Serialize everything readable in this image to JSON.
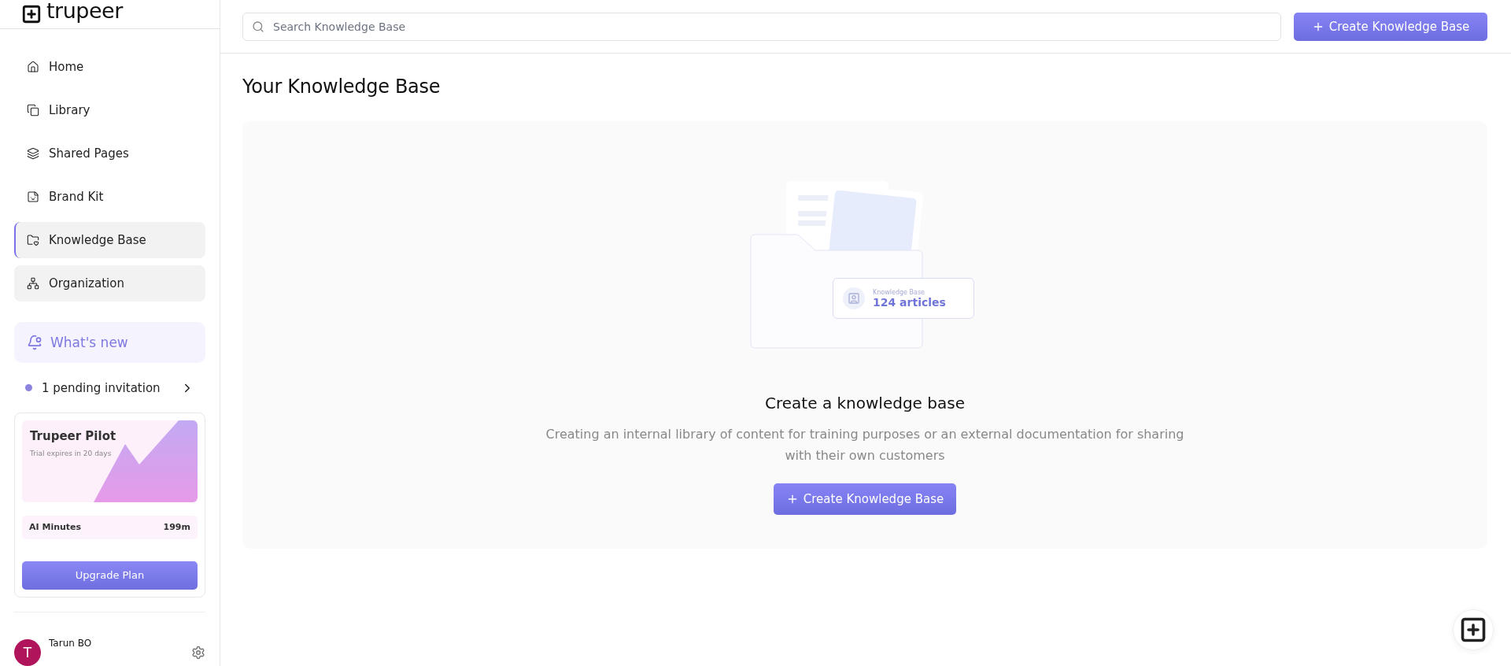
{
  "brand": {
    "name": "trupeer"
  },
  "sidebar": {
    "items": [
      {
        "label": "Home",
        "selected": false,
        "hovered": false
      },
      {
        "label": "Library",
        "selected": false,
        "hovered": false
      },
      {
        "label": "Shared Pages",
        "selected": false,
        "hovered": false
      },
      {
        "label": "Brand Kit",
        "selected": false,
        "hovered": false
      },
      {
        "label": "Knowledge Base",
        "selected": true,
        "hovered": false
      },
      {
        "label": "Organization",
        "selected": false,
        "hovered": true
      }
    ],
    "whats_new": "What's new",
    "invitation": "1 pending invitation",
    "plan_card": {
      "title": "Trupeer Pilot",
      "subtitle": "Trial expires in 20 days",
      "usage_label": "AI Minutes",
      "usage_value": "199m",
      "button": "Upgrade Plan"
    },
    "user": {
      "initial": "T",
      "name": "Tarun BO"
    }
  },
  "search": {
    "placeholder": "Search Knowledge Base"
  },
  "header_button": "Create Knowledge Base",
  "page_title": "Your Knowledge Base",
  "empty_state": {
    "illustration_badge": {
      "caption": "Knowledge Base",
      "count": "124 articles"
    },
    "heading": "Create a knowledge base",
    "description": "Creating an internal library of content for training purposes or an external documentation for sharing with their own customers",
    "button": "Create Knowledge Base"
  }
}
